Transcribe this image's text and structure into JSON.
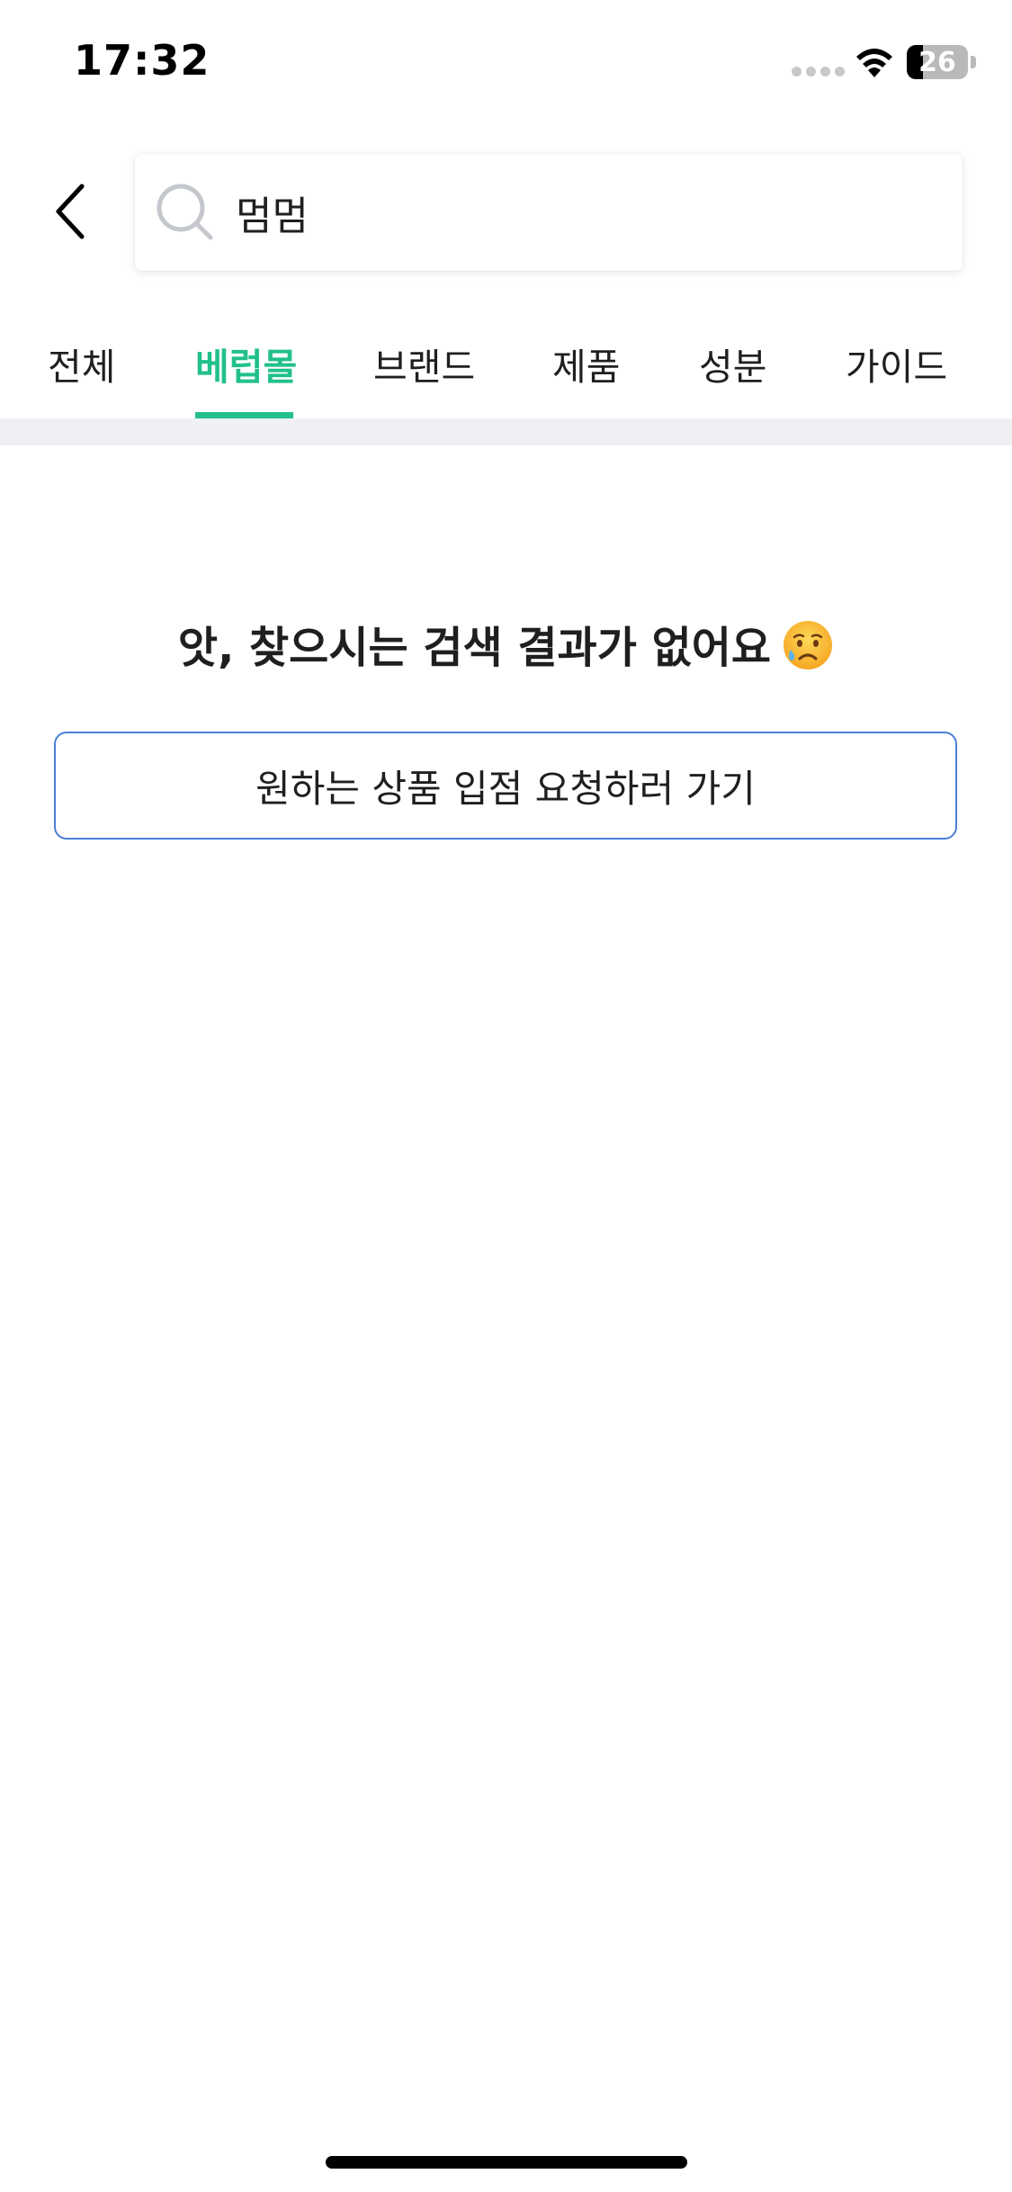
{
  "status_bar": {
    "time": "17:32",
    "battery_level": "26",
    "battery_fraction": 0.26
  },
  "header": {
    "back_icon": "chevron-left-icon",
    "search": {
      "icon": "search-icon",
      "value": "멈멈"
    }
  },
  "tabs": {
    "items": [
      {
        "label": "전체",
        "active": false
      },
      {
        "label": "베럽몰",
        "active": true
      },
      {
        "label": "브랜드",
        "active": false
      },
      {
        "label": "제품",
        "active": false
      },
      {
        "label": "성분",
        "active": false
      },
      {
        "label": "가이드",
        "active": false
      }
    ]
  },
  "empty_state": {
    "message": "앗, 찾으시는 검색 결과가 없어요",
    "emoji": "sad-tear-face-icon",
    "button_label": "원하는 상품 입점 요청하러 가기"
  },
  "colors": {
    "accent": "#22c08a",
    "button_border": "#4a7fd6",
    "divider": "#eef0f3"
  }
}
